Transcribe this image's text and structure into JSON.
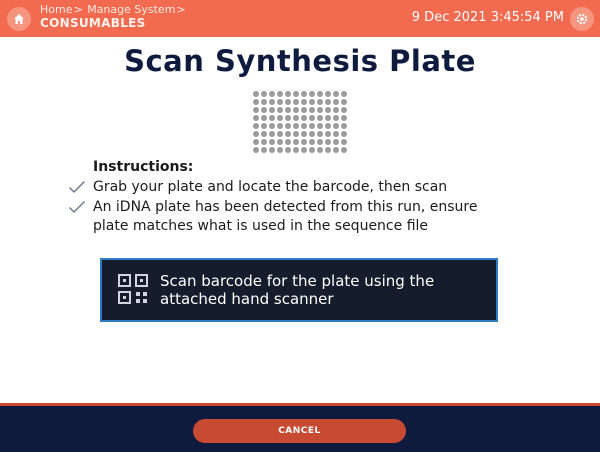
{
  "header": {
    "breadcrumb": [
      {
        "label": "Home"
      },
      {
        "label": "Manage System"
      }
    ],
    "separator": ">",
    "section_title": "CONSUMABLES",
    "datetime": "9 Dec 2021 3:45:54 PM",
    "home_icon": "home-icon",
    "settings_icon": "gear-icon",
    "accent_color": "#f26a4f"
  },
  "main": {
    "title": "Scan Synthesis Plate",
    "plate_icon": "96-well-plate-icon",
    "instructions_heading": "Instructions:",
    "steps": [
      {
        "text": "Grab your plate and locate the barcode, then scan"
      },
      {
        "text": "An iDNA plate has been detected from this run, ensure plate matches what is used in the sequence file"
      }
    ],
    "scan_prompt": "Scan barcode for the plate using the attached hand scanner",
    "scan_icon": "qr-code-icon"
  },
  "footer": {
    "cancel_label": "CANCEL",
    "button_color": "#c94a33",
    "background_color": "#0f1a3f"
  }
}
